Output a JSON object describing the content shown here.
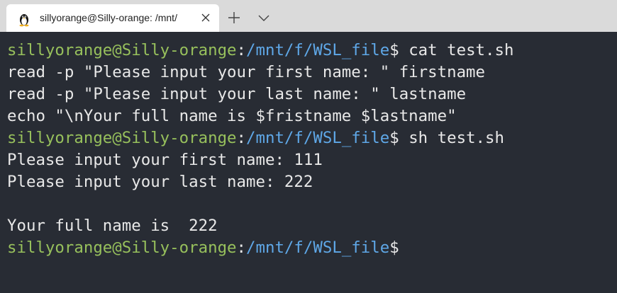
{
  "tab": {
    "title": "sillyorange@Silly-orange: /mnt/",
    "icon": "linux-penguin-icon"
  },
  "colors": {
    "background": "#282c34",
    "user_host": "#97c05c",
    "path": "#5fa8e8",
    "text": "#e8e8e8"
  },
  "terminal": {
    "prompt_user": "sillyorange@Silly-orange",
    "prompt_colon": ":",
    "prompt_path": "/mnt/f/WSL_file",
    "prompt_symbol": "$",
    "cmd1": " cat test.sh",
    "file_line1": "read -p \"Please input your first name: \" firstname",
    "file_line2": "read -p \"Please input your last name: \" lastname",
    "file_line3": "echo \"\\nYour full name is $fristname $lastname\"",
    "cmd2": " sh test.sh",
    "out_line1": "Please input your first name: 111",
    "out_line2": "Please input your last name: 222",
    "out_line3": "Your full name is  222"
  }
}
